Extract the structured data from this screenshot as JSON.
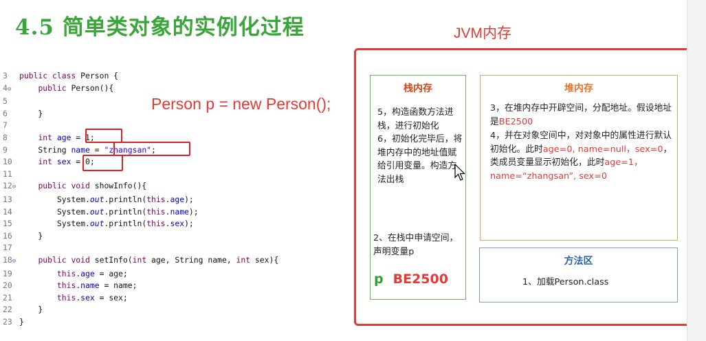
{
  "title": "4.5  简单类对象的实例化过程",
  "jvm_label": "JVM内存",
  "statement": "Person p = new Person();",
  "code_lines": [
    {
      "num": "3",
      "fold": "",
      "html": "<span class='kw'>public class</span> Person {"
    },
    {
      "num": "4",
      "fold": "⊖",
      "html": "    <span class='kw'>public</span> Person(){"
    },
    {
      "num": "5",
      "fold": "",
      "html": ""
    },
    {
      "num": "6",
      "fold": "",
      "html": "    }"
    },
    {
      "num": "7",
      "fold": "",
      "html": ""
    },
    {
      "num": "8",
      "fold": "",
      "html": "    <span class='kw'>int</span> <span class='fld'>age</span> = 1;"
    },
    {
      "num": "9",
      "fold": "",
      "html": "    String <span class='fld'>name</span> = <span class='str'>\"zhangsan\"</span>;"
    },
    {
      "num": "10",
      "fold": "",
      "html": "    <span class='kw'>int</span> <span class='fld'>sex</span> = 0;"
    },
    {
      "num": "11",
      "fold": "",
      "html": ""
    },
    {
      "num": "12",
      "fold": "⊖",
      "html": "    <span class='kw'>public void</span> showInfo(){"
    },
    {
      "num": "13",
      "fold": "",
      "html": "        System.<span class='it'>out</span>.println(<span class='kw'>this</span>.<span class='fld'>age</span>);"
    },
    {
      "num": "14",
      "fold": "",
      "html": "        System.<span class='it'>out</span>.println(<span class='kw'>this</span>.<span class='fld'>name</span>);"
    },
    {
      "num": "15",
      "fold": "",
      "html": "        System.<span class='it'>out</span>.println(<span class='kw'>this</span>.<span class='fld'>sex</span>);"
    },
    {
      "num": "16",
      "fold": "",
      "html": "    }"
    },
    {
      "num": "17",
      "fold": "",
      "html": ""
    },
    {
      "num": "18",
      "fold": "⊖",
      "html": "    <span class='kw'>public void</span> setInfo(<span class='kw'>int</span> age, String name, <span class='kw'>int</span> sex){"
    },
    {
      "num": "19",
      "fold": "",
      "html": "        <span class='kw'>this</span>.<span class='fld'>age</span> = age;"
    },
    {
      "num": "20",
      "fold": "",
      "html": "        <span class='kw'>this</span>.<span class='fld'>name</span> = name;"
    },
    {
      "num": "21",
      "fold": "",
      "html": "        <span class='kw'>this</span>.<span class='fld'>sex</span> = sex;"
    },
    {
      "num": "22",
      "fold": "",
      "html": "    }"
    },
    {
      "num": "23",
      "fold": "",
      "html": "}"
    }
  ],
  "stack": {
    "title": "栈内存",
    "step56": "5，构造函数方法进栈，进行初始化\n6，初始化完毕后，将堆内存中的地址值赋给引用变量。构造方法出栈",
    "step2": "2、在栈中申请空间，声明变量p",
    "var": "p",
    "ref": "BE2500"
  },
  "heap": {
    "title": "堆内存",
    "step3_a": "3，在堆内存中开辟空间，分配地址。假设地址是",
    "step3_addr": "BE2500",
    "step4_a": "4，并在对象空间中，对对象中的属性进行默认初始化。此时",
    "step4_default": "age=0, name=null，sex=0",
    "step4_b": "，类成员变量显示初始化，此时",
    "step4_explicit": "age=1，name=“zhangsan”, sex=0"
  },
  "method_area": {
    "title": "方法区",
    "step1": "1、加载Person.class"
  },
  "colors": {
    "title": "#3aa63a",
    "accent": "#e53935",
    "stack": "#66b85a",
    "heap": "#f0a060",
    "method": "#6fa0d8"
  }
}
